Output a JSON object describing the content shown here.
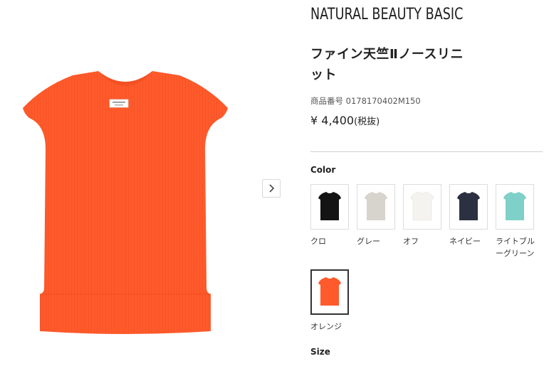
{
  "product": {
    "brand": "NATURAL BEAUTY BASIC",
    "title": "ファイン天竺Ⅱノースリニット",
    "sku_label": "商品番号",
    "sku": "0178170402M150",
    "price": "¥ 4,400",
    "tax_note": "(税抜)",
    "main_color": "#ff5a2c"
  },
  "gallery": {
    "next_icon": "chevron-right-icon"
  },
  "color_section": {
    "heading": "Color",
    "options": [
      {
        "label": "クロ",
        "color": "#141414"
      },
      {
        "label": "グレー",
        "color": "#d7d3cd"
      },
      {
        "label": "オフ",
        "color": "#f4f3ef"
      },
      {
        "label": "ネイビー",
        "color": "#2c3141"
      },
      {
        "label": "ライトブルーグリーン",
        "color": "#7fd0c8"
      },
      {
        "label": "オレンジ",
        "color": "#ff5a2c",
        "selected": true
      }
    ]
  },
  "size_section": {
    "heading": "Size"
  }
}
